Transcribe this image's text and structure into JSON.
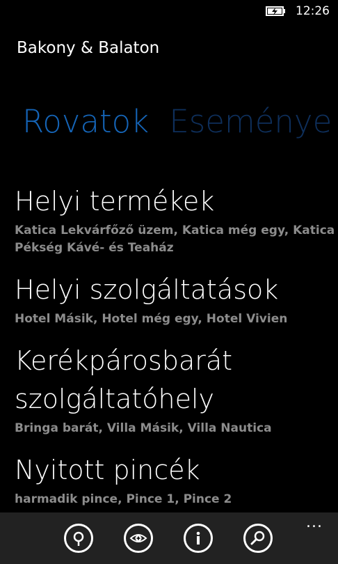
{
  "statusbar": {
    "time": "12:26"
  },
  "app": {
    "title": "Bakony & Balaton"
  },
  "pivot": {
    "active": "Rovatok",
    "next": "Eseménye"
  },
  "list": [
    {
      "title_lines": [
        "Helyi termékek"
      ],
      "subtitle": "Katica Lekvárfőző üzem, Katica még egy, Katica Pékség Kávé- és Teaház"
    },
    {
      "title_lines": [
        "Helyi szolgáltatások"
      ],
      "subtitle": "Hotel Másik, Hotel még egy, Hotel Vivien"
    },
    {
      "title_lines": [
        "Kerékpárosbarát",
        "szolgáltatóhely"
      ],
      "subtitle": "Bringa barát, Villa Másik, Villa Nautica"
    },
    {
      "title_lines": [
        "Nyitott pincék"
      ],
      "subtitle": "harmadik pince, Pince 1, Pince 2"
    }
  ],
  "appbar": {
    "buttons": [
      {
        "icon": "map-pin-icon"
      },
      {
        "icon": "eye-add-icon"
      },
      {
        "icon": "info-icon"
      },
      {
        "icon": "search-icon"
      }
    ],
    "more": "..."
  },
  "colors": {
    "accent": "#1565b8",
    "accent_dim": "#0e2f5b",
    "subtitle": "#8c8c8c",
    "appbar": "#222222"
  }
}
